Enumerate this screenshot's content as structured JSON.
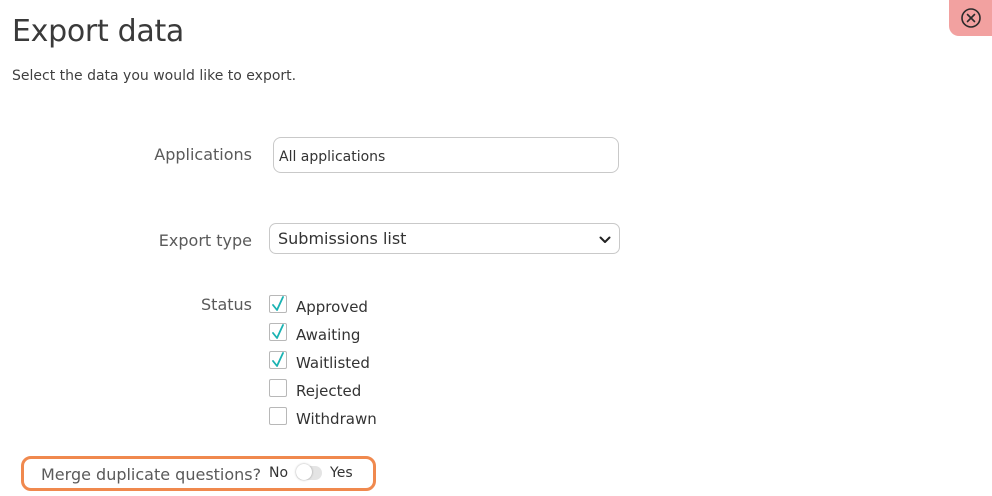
{
  "header": {
    "title": "Export data",
    "subtitle": "Select the data you would like to export."
  },
  "close": {
    "icon": "close-circle-icon",
    "color": "#f2a1a0"
  },
  "applications": {
    "label": "Applications",
    "value": "All applications"
  },
  "export_type": {
    "label": "Export type",
    "selected": "Submissions list",
    "icon": "chevron-down-icon"
  },
  "status": {
    "label": "Status",
    "check_color": "#1ab3b3",
    "items": [
      {
        "label": "Approved",
        "checked": true
      },
      {
        "label": "Awaiting",
        "checked": true
      },
      {
        "label": "Waitlisted",
        "checked": true
      },
      {
        "label": "Rejected",
        "checked": false
      },
      {
        "label": "Withdrawn",
        "checked": false
      }
    ]
  },
  "merge": {
    "label": "Merge duplicate questions?",
    "off_label": "No",
    "on_label": "Yes",
    "enabled": false,
    "highlight_color": "#f0894e"
  }
}
